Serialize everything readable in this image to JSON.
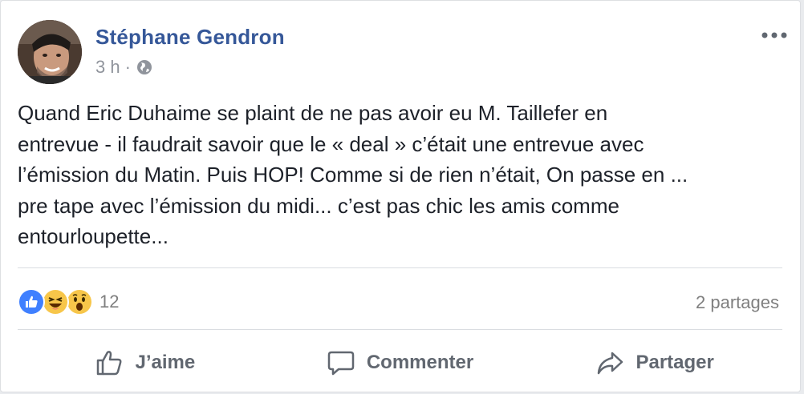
{
  "post": {
    "author": "Stéphane Gendron",
    "time": "3 h",
    "separator": "·",
    "privacy_icon": "globe-icon",
    "text": "Quand Eric Duhaime se plaint de ne pas avoir eu M. Taillefer en\nentrevue - il faudrait savoir que le « deal » c’était une entrevue avec\nl’émission du Matin. Puis HOP! Comme si de rien n’était, On passe en ...\npre tape avec l’émission du midi... c’est pas chic les amis comme\nentourloupette..."
  },
  "reactions": {
    "icons": [
      "like-icon",
      "haha-icon",
      "wow-icon"
    ],
    "count": "12"
  },
  "shares": "2 partages",
  "actions": {
    "like": "J’aime",
    "comment": "Commenter",
    "share": "Partager"
  },
  "colors": {
    "author": "#365899",
    "meta": "#90949c",
    "text": "#1d2129",
    "like_blue": "#4080ff",
    "emoji_yellow": "#f7c64a",
    "action_grey": "#616770"
  }
}
